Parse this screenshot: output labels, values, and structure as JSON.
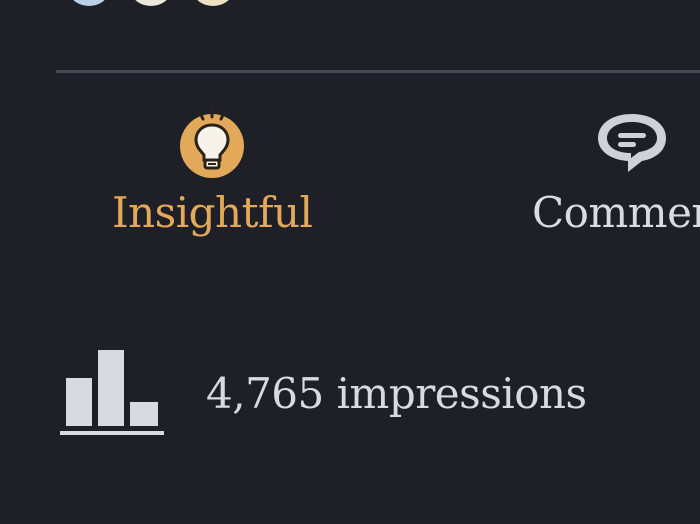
{
  "actions": {
    "insightful_label": "Insightful",
    "comment_label": "Commen"
  },
  "stats": {
    "impressions_text": "4,765 impressions"
  },
  "icons": {
    "insightful": "lightbulb-icon",
    "comment": "comment-bubble-icon",
    "analytics": "bar-chart-icon"
  },
  "colors": {
    "background": "#1f2027",
    "insightful_accent": "#e2a95a",
    "text_muted": "#d9dae0",
    "divider": "#474a54"
  }
}
